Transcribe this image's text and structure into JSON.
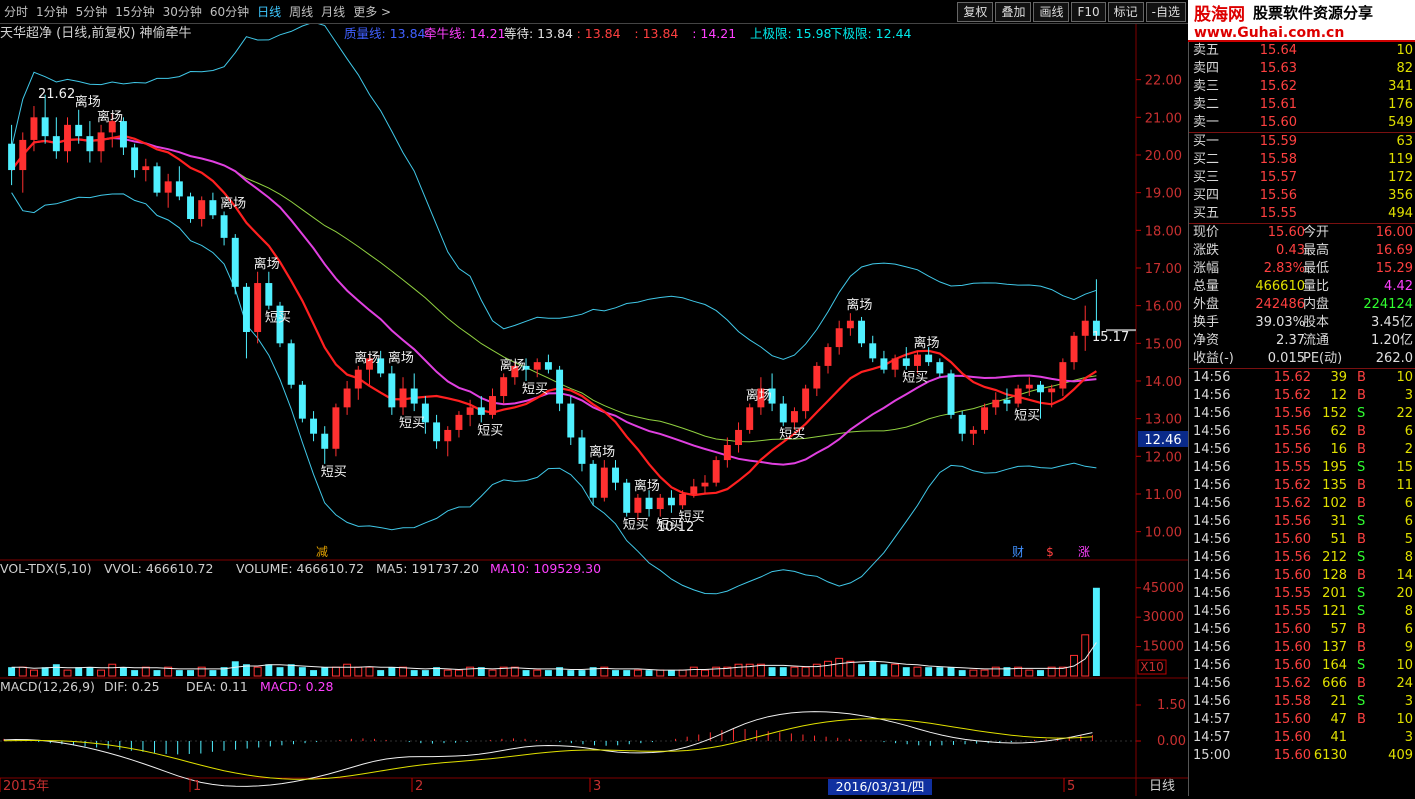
{
  "toolbar": {
    "periods": [
      "分时",
      "1分钟",
      "5分钟",
      "15分钟",
      "30分钟",
      "60分钟",
      "日线",
      "周线",
      "月线",
      "更多 >"
    ],
    "active_index": 6,
    "buttons": [
      "复权",
      "叠加",
      "画线",
      "F10",
      "标记",
      "-自选"
    ]
  },
  "logo": {
    "brand": "股海网",
    "tagline": "股票软件资源分享",
    "url": "www.Guhai.com.cn"
  },
  "main_header": {
    "stock": "天华超净 (日线,前复权) 神偷牵牛",
    "items": [
      {
        "text": "质量线: 13.84",
        "color": "#4060ff"
      },
      {
        "text": "牵牛线: 14.21",
        "color": "#ff40ff"
      },
      {
        "text": "等待: 13.84",
        "color": "#e0e0e0"
      },
      {
        "text": ": 13.84",
        "color": "#ff4040"
      },
      {
        "text": ": 13.84",
        "color": "#ff4040"
      },
      {
        "text": ": 14.21",
        "color": "#ff40ff"
      },
      {
        "text": "上极限: 15.98",
        "color": "#00e8e8"
      },
      {
        "text": "下极限: 12.44",
        "color": "#00e8e8"
      }
    ]
  },
  "price_axis": [
    "22.00",
    "21.00",
    "20.00",
    "19.00",
    "18.00",
    "17.00",
    "16.00",
    "15.00",
    "14.00",
    "13.00",
    "12.00",
    "11.00",
    "10.00"
  ],
  "price_markers": {
    "high": "21.62",
    "low": "10.12",
    "last": "15.17",
    "current": "12.46"
  },
  "signals": [
    "离场",
    "短买"
  ],
  "bottom_marks": [
    "减",
    "财",
    "$",
    "涨"
  ],
  "vol_header": {
    "name": "VOL-TDX(5,10)",
    "vvol": "VVOL: 466610.72",
    "volume": "VOLUME: 466610.72",
    "ma5": "MA5: 191737.20",
    "ma10": "MA10: 109529.30"
  },
  "vol_axis": [
    "45000",
    "30000",
    "15000"
  ],
  "vol_unit": "X10",
  "macd_header": {
    "name": "MACD(12,26,9)",
    "dif": "DIF: 0.25",
    "dea": "DEA: 0.11",
    "macd": "MACD: 0.28"
  },
  "macd_axis": [
    "1.50",
    "0.00"
  ],
  "date_axis": [
    "2015年",
    "1",
    "2",
    "3",
    "5"
  ],
  "date_cursor": "2016/03/31/四",
  "period_label": "日线",
  "candles": [
    [
      20.3,
      20.8,
      19.2,
      19.6
    ],
    [
      19.6,
      20.6,
      19.0,
      20.4
    ],
    [
      20.4,
      21.3,
      20.1,
      21.0
    ],
    [
      21.0,
      21.6,
      20.3,
      20.5
    ],
    [
      20.5,
      21.0,
      19.9,
      20.1
    ],
    [
      20.1,
      21.0,
      19.8,
      20.8
    ],
    [
      20.8,
      21.2,
      20.3,
      20.5
    ],
    [
      20.5,
      20.9,
      19.8,
      20.1
    ],
    [
      20.1,
      20.8,
      19.8,
      20.6
    ],
    [
      20.6,
      21.1,
      20.2,
      20.9
    ],
    [
      20.9,
      21.0,
      20.0,
      20.2
    ],
    [
      20.2,
      20.3,
      19.4,
      19.6
    ],
    [
      19.6,
      19.9,
      19.3,
      19.7
    ],
    [
      19.7,
      19.8,
      18.9,
      19.0
    ],
    [
      19.0,
      19.5,
      18.6,
      19.3
    ],
    [
      19.3,
      19.7,
      18.8,
      18.9
    ],
    [
      18.9,
      19.0,
      18.2,
      18.3
    ],
    [
      18.3,
      18.9,
      18.1,
      18.8
    ],
    [
      18.8,
      19.0,
      18.3,
      18.4
    ],
    [
      18.4,
      18.5,
      17.6,
      17.8
    ],
    [
      17.8,
      17.9,
      16.3,
      16.5
    ],
    [
      16.5,
      16.6,
      14.6,
      15.3
    ],
    [
      15.3,
      16.9,
      15.0,
      16.6
    ],
    [
      16.6,
      16.9,
      15.9,
      16.0
    ],
    [
      16.0,
      16.1,
      14.9,
      15.0
    ],
    [
      15.0,
      15.1,
      13.8,
      13.9
    ],
    [
      13.9,
      14.0,
      12.9,
      13.0
    ],
    [
      13.0,
      13.2,
      12.4,
      12.6
    ],
    [
      12.6,
      12.8,
      11.8,
      12.2
    ],
    [
      12.2,
      13.4,
      12.0,
      13.3
    ],
    [
      13.3,
      14.0,
      13.1,
      13.8
    ],
    [
      13.8,
      14.4,
      13.5,
      14.3
    ],
    [
      14.3,
      14.7,
      13.9,
      14.6
    ],
    [
      14.6,
      14.8,
      14.1,
      14.2
    ],
    [
      14.2,
      14.4,
      13.1,
      13.3
    ],
    [
      13.3,
      14.1,
      13.1,
      13.8
    ],
    [
      13.8,
      14.2,
      13.2,
      13.4
    ],
    [
      13.4,
      13.6,
      12.6,
      12.9
    ],
    [
      12.9,
      13.1,
      12.2,
      12.4
    ],
    [
      12.4,
      12.8,
      12.0,
      12.7
    ],
    [
      12.7,
      13.2,
      12.5,
      13.1
    ],
    [
      13.1,
      13.5,
      12.8,
      13.3
    ],
    [
      13.3,
      13.6,
      12.9,
      13.1
    ],
    [
      13.1,
      13.8,
      13.0,
      13.6
    ],
    [
      13.6,
      14.2,
      13.4,
      14.1
    ],
    [
      14.1,
      14.5,
      13.9,
      14.4
    ],
    [
      14.4,
      14.6,
      14.0,
      14.3
    ],
    [
      14.3,
      14.6,
      14.1,
      14.5
    ],
    [
      14.5,
      14.7,
      14.2,
      14.3
    ],
    [
      14.3,
      14.4,
      13.2,
      13.4
    ],
    [
      13.4,
      13.6,
      12.3,
      12.5
    ],
    [
      12.5,
      12.7,
      11.6,
      11.8
    ],
    [
      11.8,
      11.9,
      10.7,
      10.9
    ],
    [
      10.9,
      11.9,
      10.8,
      11.7
    ],
    [
      11.7,
      11.9,
      11.1,
      11.3
    ],
    [
      11.3,
      11.4,
      10.4,
      10.5
    ],
    [
      10.5,
      11.0,
      10.3,
      10.9
    ],
    [
      10.9,
      11.1,
      10.4,
      10.6
    ],
    [
      10.6,
      11.0,
      10.4,
      10.9
    ],
    [
      10.9,
      11.1,
      10.5,
      10.7
    ],
    [
      10.7,
      11.1,
      10.6,
      11.0
    ],
    [
      11.0,
      11.4,
      10.9,
      11.2
    ],
    [
      11.2,
      11.5,
      11.0,
      11.3
    ],
    [
      11.3,
      12.0,
      11.2,
      11.9
    ],
    [
      11.9,
      12.5,
      11.7,
      12.3
    ],
    [
      12.3,
      12.9,
      12.1,
      12.7
    ],
    [
      12.7,
      13.4,
      12.6,
      13.3
    ],
    [
      13.3,
      14.1,
      13.1,
      13.8
    ],
    [
      13.8,
      14.2,
      13.2,
      13.4
    ],
    [
      13.4,
      13.6,
      12.8,
      12.9
    ],
    [
      12.9,
      13.3,
      12.7,
      13.2
    ],
    [
      13.2,
      13.9,
      13.0,
      13.8
    ],
    [
      13.8,
      14.5,
      13.6,
      14.4
    ],
    [
      14.4,
      15.0,
      14.2,
      14.9
    ],
    [
      14.9,
      15.6,
      14.7,
      15.4
    ],
    [
      15.4,
      15.8,
      15.2,
      15.6
    ],
    [
      15.6,
      15.7,
      14.9,
      15.0
    ],
    [
      15.0,
      15.2,
      14.5,
      14.6
    ],
    [
      14.6,
      14.8,
      14.2,
      14.3
    ],
    [
      14.3,
      14.7,
      14.1,
      14.6
    ],
    [
      14.6,
      14.9,
      14.3,
      14.4
    ],
    [
      14.4,
      14.8,
      14.2,
      14.7
    ],
    [
      14.7,
      14.9,
      14.4,
      14.5
    ],
    [
      14.5,
      14.6,
      14.1,
      14.2
    ],
    [
      14.2,
      14.3,
      13.0,
      13.1
    ],
    [
      13.1,
      13.2,
      12.4,
      12.6
    ],
    [
      12.6,
      12.8,
      12.3,
      12.7
    ],
    [
      12.7,
      13.4,
      12.6,
      13.3
    ],
    [
      13.3,
      13.7,
      13.1,
      13.5
    ],
    [
      13.5,
      13.8,
      13.2,
      13.4
    ],
    [
      13.4,
      13.9,
      13.3,
      13.8
    ],
    [
      13.8,
      14.1,
      13.6,
      13.9
    ],
    [
      13.9,
      14.0,
      13.0,
      13.7
    ],
    [
      13.7,
      13.9,
      13.3,
      13.8
    ],
    [
      13.8,
      14.6,
      13.6,
      14.5
    ],
    [
      14.5,
      15.3,
      14.3,
      15.2
    ],
    [
      15.2,
      16.0,
      14.8,
      15.6
    ],
    [
      15.6,
      16.7,
      15.3,
      15.2
    ]
  ],
  "volumes": [
    3,
    3,
    2,
    3,
    4,
    2,
    3,
    3,
    2,
    4,
    3,
    2,
    3,
    2,
    3,
    2,
    2,
    3,
    2,
    3,
    5,
    4,
    3,
    4,
    3,
    4,
    3,
    2,
    3,
    3,
    4,
    3,
    3,
    2,
    3,
    3,
    2,
    2,
    3,
    2,
    2,
    3,
    3,
    2,
    3,
    3,
    2,
    2,
    2,
    3,
    2,
    2,
    3,
    3,
    2,
    2,
    2,
    2,
    2,
    2,
    2,
    3,
    2,
    3,
    3,
    4,
    4,
    4,
    3,
    3,
    3,
    3,
    4,
    5,
    6,
    5,
    4,
    5,
    4,
    4,
    3,
    3,
    3,
    3,
    3,
    2,
    2,
    2,
    3,
    3,
    3,
    2,
    2,
    3,
    3,
    7,
    14,
    30
  ],
  "macd_hist": [
    0.1,
    0.05,
    0.0,
    -0.05,
    -0.1,
    -0.15,
    -0.2,
    -0.25,
    -0.3,
    -0.35,
    -0.4,
    -0.45,
    -0.5,
    -0.55,
    -0.6,
    -0.62,
    -0.6,
    -0.58,
    -0.5,
    -0.45,
    -0.4,
    -0.35,
    -0.3,
    -0.25,
    -0.2,
    -0.15,
    -0.1,
    -0.05,
    0.0,
    0.05,
    0.1,
    0.12,
    0.1,
    0.05,
    0.0,
    -0.05,
    -0.1,
    -0.12,
    -0.1,
    -0.08,
    -0.05,
    0.0,
    0.05,
    0.1,
    0.12,
    0.1,
    0.05,
    0.0,
    -0.05,
    -0.1,
    -0.15,
    -0.2,
    -0.22,
    -0.2,
    -0.15,
    -0.1,
    -0.05,
    0.0,
    0.1,
    0.2,
    0.3,
    0.4,
    0.5,
    0.55,
    0.55,
    0.5,
    0.45,
    0.4,
    0.35,
    0.3,
    0.25,
    0.2,
    0.15,
    0.1,
    0.05,
    0.0,
    -0.05,
    -0.1,
    -0.15,
    -0.2,
    -0.22,
    -0.2,
    -0.18,
    -0.15,
    -0.12,
    -0.1,
    -0.08,
    -0.05,
    0.0,
    0.05,
    0.1,
    0.15,
    0.2,
    0.25,
    0.28
  ],
  "quote": {
    "asks": [
      {
        "label": "卖五",
        "price": "15.64",
        "vol": "10"
      },
      {
        "label": "卖四",
        "price": "15.63",
        "vol": "82"
      },
      {
        "label": "卖三",
        "price": "15.62",
        "vol": "341"
      },
      {
        "label": "卖二",
        "price": "15.61",
        "vol": "176"
      },
      {
        "label": "卖一",
        "price": "15.60",
        "vol": "549"
      }
    ],
    "bids": [
      {
        "label": "买一",
        "price": "15.59",
        "vol": "63"
      },
      {
        "label": "买二",
        "price": "15.58",
        "vol": "119"
      },
      {
        "label": "买三",
        "price": "15.57",
        "vol": "172"
      },
      {
        "label": "买四",
        "price": "15.56",
        "vol": "356"
      },
      {
        "label": "买五",
        "price": "15.55",
        "vol": "494"
      }
    ],
    "stats": [
      [
        {
          "l": "现价",
          "v": "15.60",
          "c": "red"
        },
        {
          "l": "今开",
          "v": "16.00",
          "c": "red"
        }
      ],
      [
        {
          "l": "涨跌",
          "v": "0.43",
          "c": "red"
        },
        {
          "l": "最高",
          "v": "16.69",
          "c": "red"
        }
      ],
      [
        {
          "l": "涨幅",
          "v": "2.83%",
          "c": "red"
        },
        {
          "l": "最低",
          "v": "15.29",
          "c": "red"
        }
      ],
      [
        {
          "l": "总量",
          "v": "466610",
          "c": "yellow"
        },
        {
          "l": "量比",
          "v": "4.42",
          "c": "mag"
        }
      ],
      [
        {
          "l": "外盘",
          "v": "242486",
          "c": "red"
        },
        {
          "l": "内盘",
          "v": "224124",
          "c": "green"
        }
      ],
      [
        {
          "l": "换手",
          "v": "39.03%",
          "c": "white"
        },
        {
          "l": "股本",
          "v": "3.45亿",
          "c": "white"
        }
      ],
      [
        {
          "l": "净资",
          "v": "2.37",
          "c": "white"
        },
        {
          "l": "流通",
          "v": "1.20亿",
          "c": "white"
        }
      ],
      [
        {
          "l": "收益(-)",
          "v": "0.015",
          "c": "white"
        },
        {
          "l": "PE(动)",
          "v": "262.0",
          "c": "white"
        }
      ]
    ],
    "ticks": [
      {
        "t": "14:56",
        "p": "15.62",
        "v": "39",
        "bs": "B",
        "n": "10"
      },
      {
        "t": "14:56",
        "p": "15.62",
        "v": "12",
        "bs": "B",
        "n": "3"
      },
      {
        "t": "14:56",
        "p": "15.56",
        "v": "152",
        "bs": "S",
        "n": "22"
      },
      {
        "t": "14:56",
        "p": "15.56",
        "v": "62",
        "bs": "B",
        "n": "6"
      },
      {
        "t": "14:56",
        "p": "15.56",
        "v": "16",
        "bs": "B",
        "n": "2"
      },
      {
        "t": "14:56",
        "p": "15.55",
        "v": "195",
        "bs": "S",
        "n": "15"
      },
      {
        "t": "14:56",
        "p": "15.62",
        "v": "135",
        "bs": "B",
        "n": "11"
      },
      {
        "t": "14:56",
        "p": "15.62",
        "v": "102",
        "bs": "B",
        "n": "6"
      },
      {
        "t": "14:56",
        "p": "15.56",
        "v": "31",
        "bs": "S",
        "n": "6"
      },
      {
        "t": "14:56",
        "p": "15.60",
        "v": "51",
        "bs": "B",
        "n": "5"
      },
      {
        "t": "14:56",
        "p": "15.56",
        "v": "212",
        "bs": "S",
        "n": "8"
      },
      {
        "t": "14:56",
        "p": "15.60",
        "v": "128",
        "bs": "B",
        "n": "14"
      },
      {
        "t": "14:56",
        "p": "15.55",
        "v": "201",
        "bs": "S",
        "n": "20"
      },
      {
        "t": "14:56",
        "p": "15.55",
        "v": "121",
        "bs": "S",
        "n": "8"
      },
      {
        "t": "14:56",
        "p": "15.60",
        "v": "57",
        "bs": "B",
        "n": "6"
      },
      {
        "t": "14:56",
        "p": "15.60",
        "v": "137",
        "bs": "B",
        "n": "9"
      },
      {
        "t": "14:56",
        "p": "15.60",
        "v": "164",
        "bs": "S",
        "n": "10"
      },
      {
        "t": "14:56",
        "p": "15.62",
        "v": "666",
        "bs": "B",
        "n": "24"
      },
      {
        "t": "14:56",
        "p": "15.58",
        "v": "21",
        "bs": "S",
        "n": "3"
      },
      {
        "t": "14:57",
        "p": "15.60",
        "v": "47",
        "bs": "B",
        "n": "10"
      },
      {
        "t": "14:57",
        "p": "15.60",
        "v": "41",
        "bs": "",
        "n": "3"
      },
      {
        "t": "15:00",
        "p": "15.60",
        "v": "6130",
        "bs": "",
        "n": "409"
      }
    ]
  },
  "colors": {
    "up": "#ff3030",
    "down": "#50f0ff",
    "boll": "#40c8e8",
    "ma_red": "#ff2020",
    "ma_mag": "#e040e0",
    "ma_green": "#90d040",
    "bg": "#000000",
    "grid_red": "#800000"
  }
}
